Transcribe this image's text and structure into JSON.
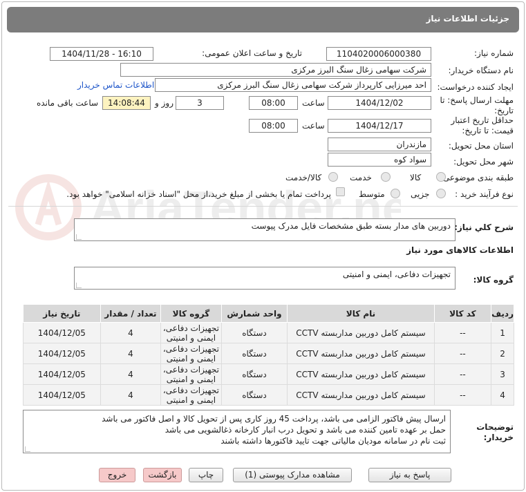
{
  "header": {
    "title": "جزئیات اطلاعات نیاز"
  },
  "watermark": {
    "text": "AriaTender.net"
  },
  "fields": {
    "need_number_label": "شماره نیاز:",
    "need_number": "1104020006000380",
    "announce_label": "تاریخ و ساعت اعلان عمومی:",
    "announce_value": "1404/11/28 - 16:10",
    "buyer_org_label": "نام دستگاه خریدار:",
    "buyer_org": "شرکت سهامی زغال سنگ البرز مرکزی",
    "creator_label": "ایجاد کننده درخواست:",
    "creator": "احد میرزایی کارپرداز شرکت سهامی زغال سنگ البرز مرکزی",
    "contact_link": "اطلاعات تماس خریدار",
    "deadline_label_1": "مهلت ارسال پاسخ: تا",
    "deadline_label_2": "تاریخ:",
    "deadline_date": "1404/12/02",
    "time_label": "ساعت",
    "deadline_time": "08:00",
    "days_value": "3",
    "days_label": "روز و",
    "remaining_time": "14:08:44",
    "remaining_label": "ساعت باقی مانده",
    "validity_label_1": "حداقل تاریخ اعتبار",
    "validity_label_2": "قیمت: تا تاریخ:",
    "validity_date": "1404/12/17",
    "validity_time": "08:00",
    "province_label": "استان محل تحویل:",
    "province": "مازندران",
    "city_label": "شهر محل تحویل:",
    "city": "سواد کوه",
    "category_label": "طبقه بندی موضوعی:",
    "category_options": [
      "کالا",
      "خدمت",
      "کالا/خدمت"
    ],
    "process_label": "نوع فرآیند خرید :",
    "process_options": [
      "جزیی",
      "متوسط"
    ],
    "payment_note": "پرداخت تمام یا بخشی از مبلغ خرید،از محل \"اسناد خزانه اسلامی\" خواهد بود."
  },
  "description": {
    "label": "شرح کلي نياز:",
    "text": "دوربین های مدار بسته طبق مشخصات فایل مدرک پیوست"
  },
  "goods_section": {
    "title": "اطلاعات کالاهای مورد نیاز",
    "group_label": "گروه کالا:",
    "group_value": "تجهیزات دفاعی، ایمنی و امنیتی"
  },
  "table": {
    "headers": [
      "ردیف",
      "کد کالا",
      "نام کالا",
      "واحد شمارش",
      "گروه کالا",
      "تعداد / مقدار",
      "تاریخ نیاز"
    ],
    "rows": [
      [
        "1",
        "--",
        "سیستم کامل دوربین مداربسته CCTV",
        "دستگاه",
        "تجهیزات دفاعی، ایمنی و امنیتی",
        "4",
        "1404/12/05"
      ],
      [
        "2",
        "--",
        "سیستم کامل دوربین مداربسته CCTV",
        "دستگاه",
        "تجهیزات دفاعی، ایمنی و امنیتی",
        "4",
        "1404/12/05"
      ],
      [
        "3",
        "--",
        "سیستم کامل دوربین مداربسته CCTV",
        "دستگاه",
        "تجهیزات دفاعی، ایمنی و امنیتی",
        "4",
        "1404/12/05"
      ],
      [
        "4",
        "--",
        "سیستم کامل دوربین مداربسته CCTV",
        "دستگاه",
        "تجهیزات دفاعی، ایمنی و امنیتی",
        "4",
        "1404/12/05"
      ]
    ]
  },
  "buyer_notes": {
    "label_1": "توضیحات",
    "label_2": "خریدار:",
    "lines": [
      "ارسال پیش فاکتور الزامی می باشد، پرداخت 45 روز کاری پس از تحویل کالا و اصل فاکتور می باشد",
      "حمل بر عهده تامین کننده می باشد و تحویل درب انبار کارخانه ذغالشویی می باشد",
      "ثبت نام در سامانه مودیان مالیاتی جهت تایید فاکتورها داشته باشند"
    ]
  },
  "buttons": {
    "reply": "پاسخ به نیاز",
    "view_docs": "مشاهده مدارک پیوستی (1)",
    "print": "چاپ",
    "back": "بازگشت",
    "exit": "خروج"
  },
  "colors": {
    "header_bg": "#7c7c7c",
    "link": "#1d55c9",
    "remaining_bg": "#fdf3c0",
    "button_pink": "#f6c9c9"
  }
}
